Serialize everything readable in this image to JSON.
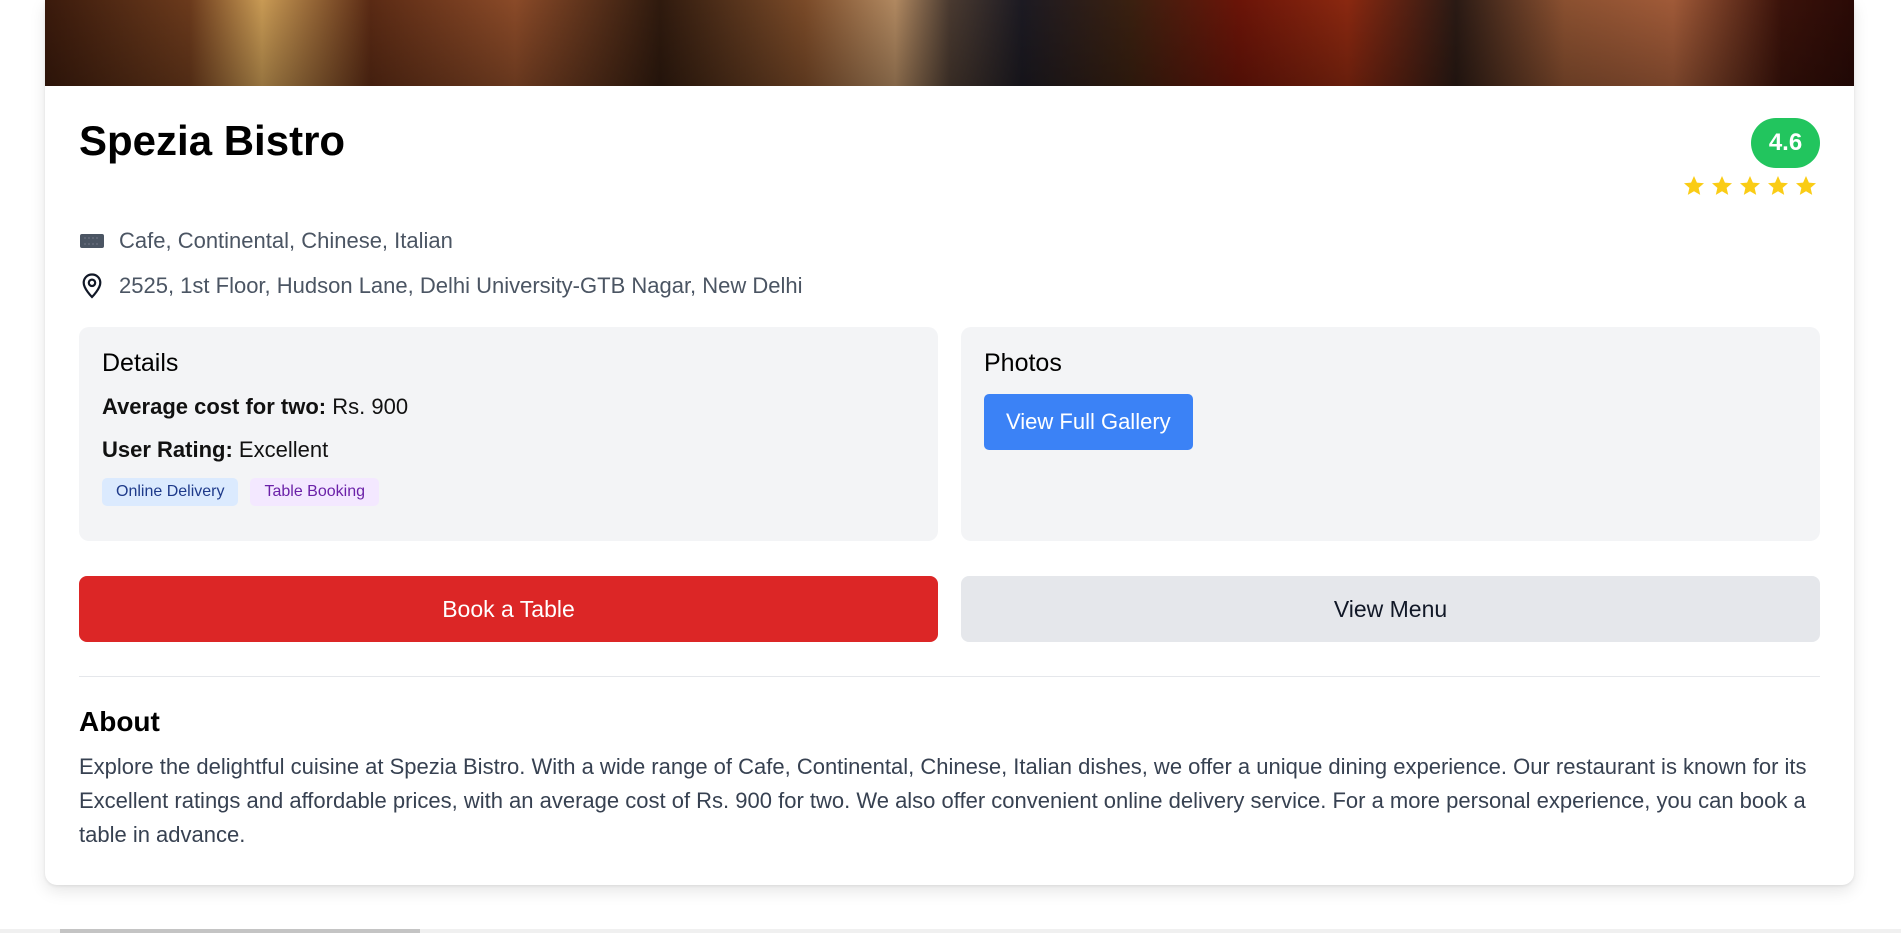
{
  "restaurant": {
    "name": "Spezia Bistro",
    "rating": "4.6",
    "star_count": 5,
    "cuisines": "Cafe, Continental, Chinese, Italian",
    "address": "2525, 1st Floor, Hudson Lane, Delhi University-GTB Nagar, New Delhi"
  },
  "details": {
    "heading": "Details",
    "avg_cost_label": "Average cost for two:",
    "avg_cost_value": "Rs. 900",
    "user_rating_label": "User Rating:",
    "user_rating_value": "Excellent",
    "tags": [
      "Online Delivery",
      "Table Booking"
    ]
  },
  "photos": {
    "heading": "Photos",
    "gallery_button": "View Full Gallery"
  },
  "actions": {
    "book_table": "Book a Table",
    "view_menu": "View Menu"
  },
  "about": {
    "heading": "About",
    "text": "Explore the delightful cuisine at Spezia Bistro. With a wide range of Cafe, Continental, Chinese, Italian dishes, we offer a unique dining experience. Our restaurant is known for its Excellent ratings and affordable prices, with an average cost of Rs. 900 for two. We also offer convenient online delivery service. For a more personal experience, you can book a table in advance."
  },
  "colors": {
    "rating_badge": "#22c55e",
    "star": "#facc15",
    "book_button": "#dc2626",
    "gallery_button": "#3b82f6",
    "panel_bg": "#f3f4f6"
  },
  "icons": {
    "cuisine": "utensils-icon",
    "address": "map-pin-icon",
    "star": "star-icon"
  }
}
